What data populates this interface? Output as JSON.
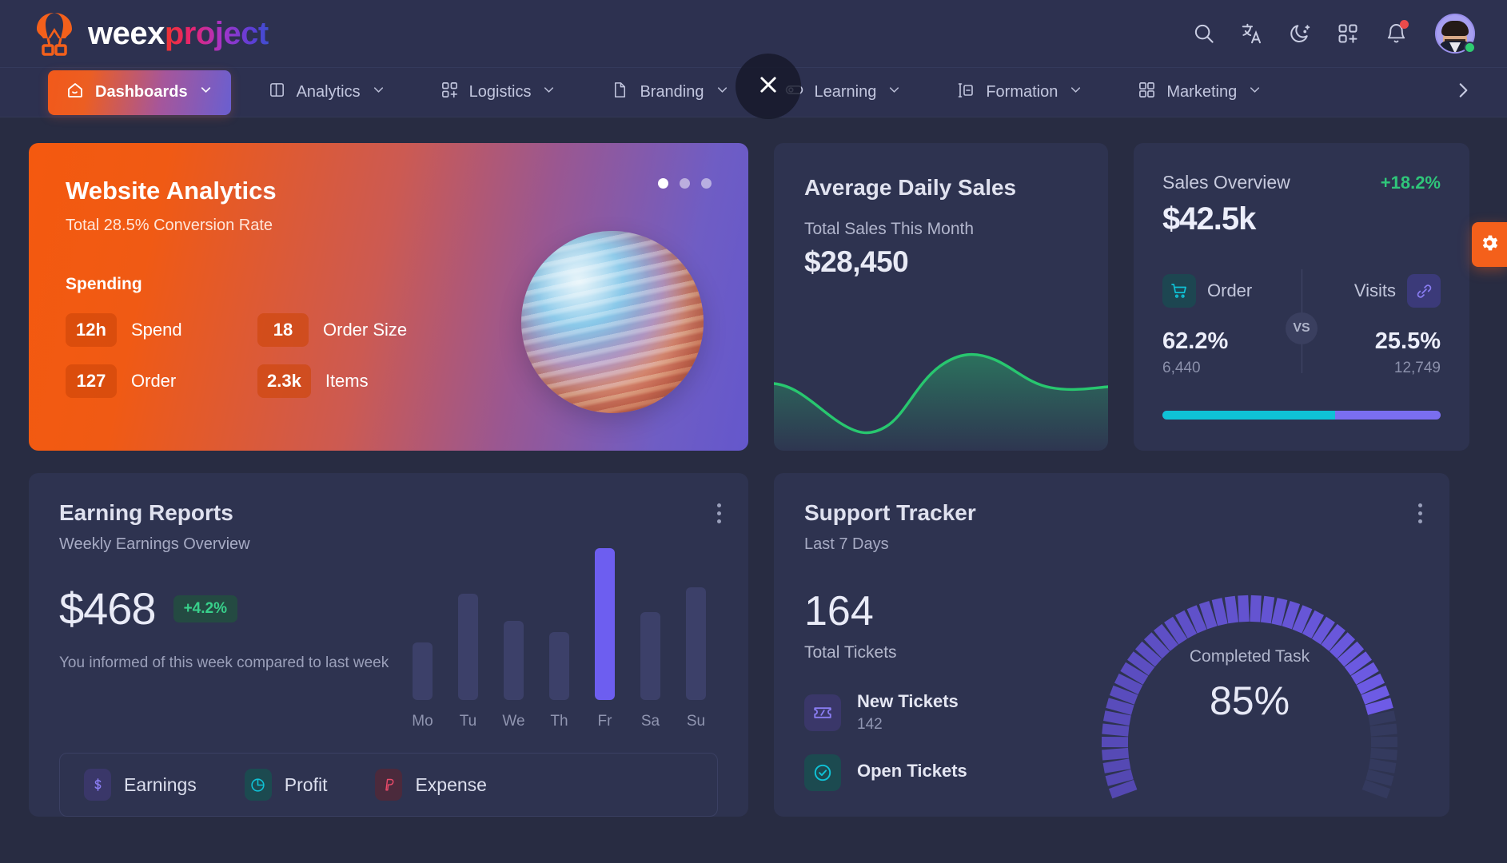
{
  "header": {
    "logo_primary": "weex",
    "logo_secondary": "project",
    "icons": {
      "search": "search-icon",
      "translate": "translate-icon",
      "dark_mode": "moon-icon",
      "apps": "grid-plus-icon",
      "notifications": "bell-icon"
    }
  },
  "nav": {
    "items": [
      {
        "label": "Dashboards",
        "icon": "home-icon",
        "active": true
      },
      {
        "label": "Analytics",
        "icon": "panel-icon",
        "active": false
      },
      {
        "label": "Logistics",
        "icon": "grid-plus-icon",
        "active": false
      },
      {
        "label": "Branding",
        "icon": "file-icon",
        "active": false
      },
      {
        "label": "Learning",
        "icon": "toggle-icon",
        "active": false
      },
      {
        "label": "Formation",
        "icon": "layout-icon",
        "active": false
      },
      {
        "label": "Marketing",
        "icon": "grid-icon",
        "active": false
      }
    ],
    "more": "chevron-right-icon",
    "close_overlay": "close-icon"
  },
  "website_analytics": {
    "title": "Website Analytics",
    "subtitle": "Total 28.5% Conversion Rate",
    "section_label": "Spending",
    "stats": [
      {
        "value": "12h",
        "label": "Spend"
      },
      {
        "value": "18",
        "label": "Order Size"
      },
      {
        "value": "127",
        "label": "Order"
      },
      {
        "value": "2.3k",
        "label": "Items"
      }
    ],
    "carousel": {
      "total": 3,
      "active": 0
    }
  },
  "average_daily_sales": {
    "title": "Average Daily Sales",
    "subtitle": "Total Sales This Month",
    "value": "$28,450",
    "line_color": "#28c76f"
  },
  "sales_overview": {
    "title": "Sales Overview",
    "delta": "+18.2%",
    "value": "$42.5k",
    "vs_label": "VS",
    "left": {
      "label": "Order",
      "percent": "62.2%",
      "count": "6,440",
      "icon": "cart-icon",
      "color": "#0fc2d6"
    },
    "right": {
      "label": "Visits",
      "percent": "25.5%",
      "count": "12,749",
      "icon": "link-icon",
      "color": "#7a6ef0"
    },
    "bar_fill_percent": 62.2
  },
  "earning_reports": {
    "title": "Earning Reports",
    "subtitle": "Weekly Earnings Overview",
    "amount": "$468",
    "badge": "+4.2%",
    "note": "You informed of this week compared to last week",
    "menu_icon": "kebab-menu-icon",
    "legend": [
      {
        "label": "Earnings",
        "icon": "dollar-icon",
        "color": "#7a6ef0"
      },
      {
        "label": "Profit",
        "icon": "pie-chart-icon",
        "color": "#0fc2d6"
      },
      {
        "label": "Expense",
        "icon": "paypal-icon",
        "color": "#ea4b6a"
      }
    ]
  },
  "support_tracker": {
    "title": "Support Tracker",
    "subtitle": "Last 7 Days",
    "total": "164",
    "total_label": "Total Tickets",
    "menu_icon": "kebab-menu-icon",
    "rows": [
      {
        "label": "New Tickets",
        "value": "142",
        "icon": "ticket-icon"
      },
      {
        "label": "Open Tickets",
        "value": "",
        "icon": "check-circle-icon"
      }
    ],
    "gauge": {
      "label": "Completed Task",
      "value": "85%",
      "percent": 85
    }
  },
  "fab": {
    "icon": "gear-icon",
    "color": "#f4601b"
  },
  "chart_data": [
    {
      "type": "area",
      "title": "Average Daily Sales",
      "x": [
        0,
        1,
        2,
        3,
        4,
        5,
        6,
        7,
        8
      ],
      "values": [
        42,
        36,
        22,
        14,
        18,
        46,
        74,
        78,
        66
      ],
      "ylim": [
        0,
        100
      ],
      "grid": false,
      "legend": "none",
      "series_color": "#28c76f"
    },
    {
      "type": "bar",
      "title": "Earning Reports",
      "subtitle": "Weekly Earnings Overview",
      "categories": [
        "Mo",
        "Tu",
        "We",
        "Th",
        "Fr",
        "Sa",
        "Su"
      ],
      "values": [
        38,
        70,
        52,
        45,
        100,
        58,
        74
      ],
      "highlight_index": 4,
      "ylim": [
        0,
        100
      ],
      "xlabel": "",
      "ylabel": "",
      "grid": false
    },
    {
      "type": "pie",
      "title": "Completed Task",
      "categories": [
        "Completed",
        "Remaining"
      ],
      "values": [
        85,
        15
      ],
      "annotation": "85%"
    }
  ]
}
